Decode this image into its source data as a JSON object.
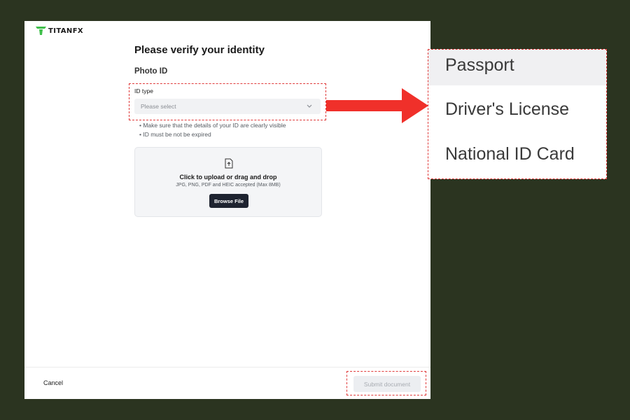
{
  "brand": {
    "name": "TITANFX",
    "logo_color": "#3fbf4a"
  },
  "page": {
    "title": "Please verify your identity",
    "section": "Photo ID"
  },
  "id_type": {
    "label": "ID type",
    "placeholder": "Please select"
  },
  "hints": [
    "Make sure that the details of your ID are clearly visible",
    "ID must be not be expired"
  ],
  "upload": {
    "icon": "file-upload-icon",
    "title": "Click to upload or drag and drop",
    "subtitle": "JPG, PNG, PDF and HEIC accepted (Max 8MB)",
    "browse_label": "Browse File"
  },
  "footer": {
    "cancel_label": "Cancel",
    "submit_label": "Submit document"
  },
  "dropdown_options": [
    "Passport",
    "Driver's License",
    "National ID Card"
  ],
  "annotation": {
    "color": "#e03b3b"
  }
}
